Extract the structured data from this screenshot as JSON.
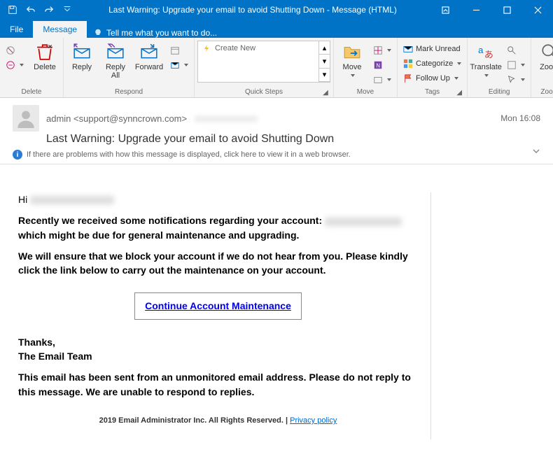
{
  "window": {
    "title": "Last Warning: Upgrade your email to avoid Shutting Down - Message (HTML)"
  },
  "tabs": {
    "file": "File",
    "message": "Message",
    "tellme": "Tell me what you want to do..."
  },
  "ribbon": {
    "delete_grp": "Delete",
    "delete": "Delete",
    "respond_grp": "Respond",
    "reply": "Reply",
    "reply_all": "Reply\nAll",
    "forward": "Forward",
    "quicksteps_grp": "Quick Steps",
    "create_new": "Create New",
    "move_grp": "Move",
    "move": "Move",
    "tags_grp": "Tags",
    "mark_unread": "Mark Unread",
    "categorize": "Categorize",
    "follow_up": "Follow Up",
    "editing_grp": "Editing",
    "translate": "Translate",
    "zoom_grp": "Zoom",
    "zoom": "Zoom"
  },
  "message": {
    "from_name": "admin",
    "from_email": "<support@synncrown.com>",
    "date": "Mon 16:08",
    "subject": "Last Warning: Upgrade your email to avoid Shutting Down",
    "info_bar": "If there are problems with how this message is displayed, click here to view it in a web browser."
  },
  "body": {
    "greeting": "Hi",
    "p1a": "Recently we received some notifications regarding your account:",
    "p1b": "which might be due for general maintenance and upgrading.",
    "p2": "We will ensure that we block your account if we do not hear from you. Please kindly click the link below to carry out the maintenance on your account.",
    "cta": "Continue Account Maintenance",
    "sig1": "Thanks,",
    "sig2": "The Email Team",
    "disclaimer": "This email has been sent from an unmonitored email address. Please do not reply to this message. We are unable to respond to replies.",
    "footer_text": "2019 Email Administrator Inc. All Rights Reserved. | ",
    "footer_link": "Privacy policy"
  }
}
